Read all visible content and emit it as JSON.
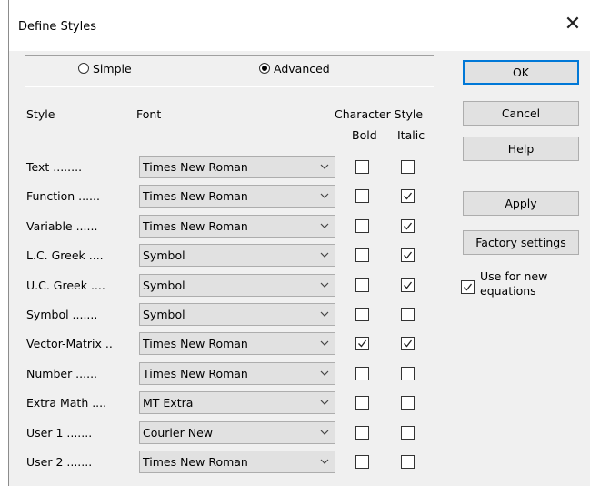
{
  "window": {
    "title": "Define Styles",
    "close_glyph": "✕"
  },
  "mode": {
    "simple_label": "Simple",
    "advanced_label": "Advanced",
    "selected": "Advanced"
  },
  "headers": {
    "style": "Style",
    "font": "Font",
    "character_style": "Character Style",
    "bold": "Bold",
    "italic": "Italic"
  },
  "rows": [
    {
      "style": "Text ........",
      "font": "Times New Roman",
      "bold": false,
      "italic": false
    },
    {
      "style": "Function ......",
      "font": "Times New Roman",
      "bold": false,
      "italic": true
    },
    {
      "style": "Variable ......",
      "font": "Times New Roman",
      "bold": false,
      "italic": true
    },
    {
      "style": "L.C. Greek ....",
      "font": "Symbol",
      "bold": false,
      "italic": true
    },
    {
      "style": "U.C. Greek ....",
      "font": "Symbol",
      "bold": false,
      "italic": true
    },
    {
      "style": "Symbol .......",
      "font": "Symbol",
      "bold": false,
      "italic": false
    },
    {
      "style": "Vector-Matrix ..",
      "font": "Times New Roman",
      "bold": true,
      "italic": true
    },
    {
      "style": "Number ......",
      "font": "Times New Roman",
      "bold": false,
      "italic": false
    },
    {
      "style": "Extra Math ....",
      "font": "MT Extra",
      "bold": false,
      "italic": false
    },
    {
      "style": "User 1 .......",
      "font": "Courier New",
      "bold": false,
      "italic": false
    },
    {
      "style": "User 2 .......",
      "font": "Times New Roman",
      "bold": false,
      "italic": false
    }
  ],
  "buttons": {
    "ok": "OK",
    "cancel": "Cancel",
    "help": "Help",
    "apply": "Apply",
    "factory": "Factory settings"
  },
  "use_for_new": {
    "label": "Use for new equations",
    "checked": true
  },
  "colors": {
    "accent": "#0078d7",
    "dialog_bg": "#f0f0f0",
    "button_bg": "#e1e1e1"
  }
}
